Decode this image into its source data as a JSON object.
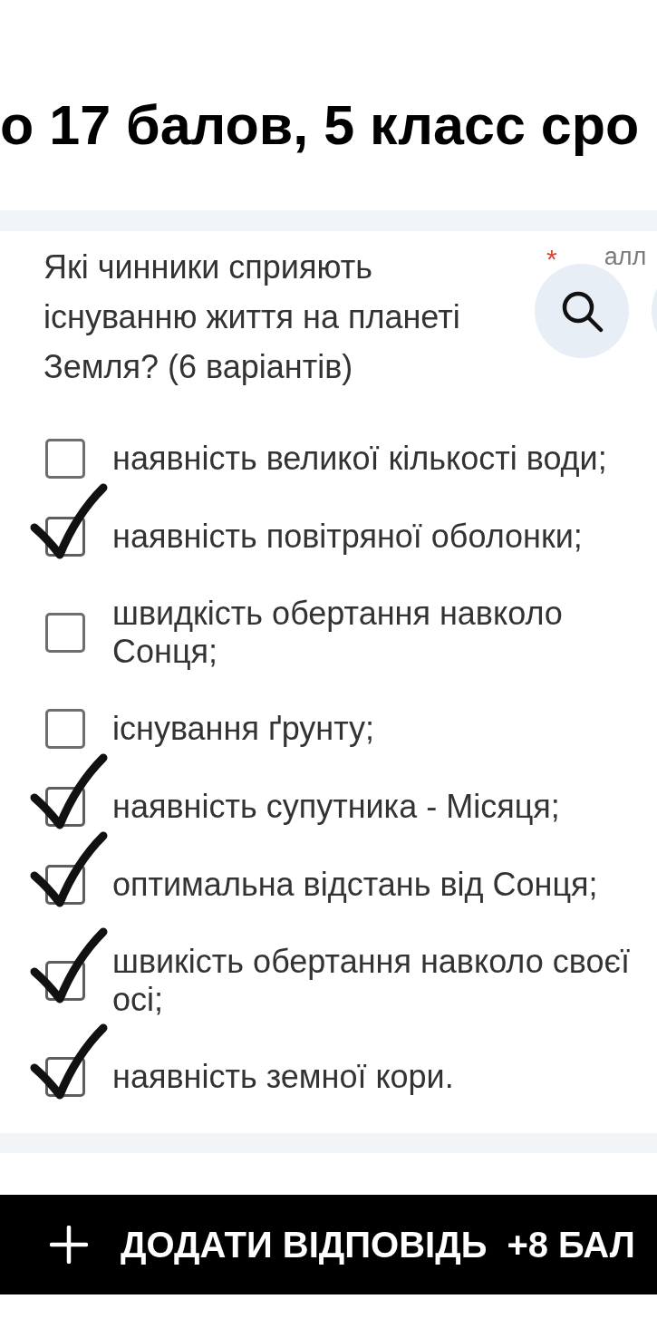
{
  "page_title": "о 17 балов, 5 класс сро",
  "question": {
    "text": "Які чинники сприяють існуванню життя на планеті Земля? (6 варіантів)",
    "required_mark": "*",
    "points": "алл",
    "options": [
      {
        "label": "наявність великої кількості води;",
        "checked": false
      },
      {
        "label": "наявність повітряної оболонки;",
        "checked": true
      },
      {
        "label": "швидкість обертання навколо Сонця;",
        "checked": false
      },
      {
        "label": "існування ґрунту;",
        "checked": false
      },
      {
        "label": "наявність супутника - Місяця;",
        "checked": true
      },
      {
        "label": "оптимальна відстань від Сонця;",
        "checked": true
      },
      {
        "label": "швикість обертання навколо своєї осі;",
        "checked": true
      },
      {
        "label": "наявність земної кори.",
        "checked": true
      }
    ]
  },
  "add_answer_button": {
    "label": "ДОДАТИ ВІДПОВІДЬ",
    "points": "+8 БАЛ"
  }
}
